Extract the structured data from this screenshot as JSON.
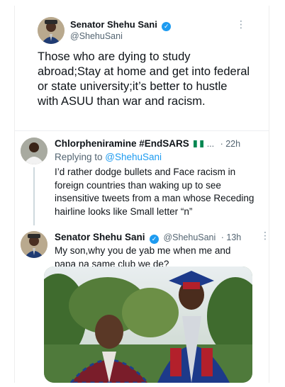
{
  "main_tweet": {
    "author": "Senator Shehu Sani",
    "handle": "@ShehuSani",
    "text": "Those who are dying to study abroad;Stay at home and get into federal or state university;it’s better to hustle with ASUU than war and racism."
  },
  "reply1": {
    "author": "Chlorpheniramine #EndSARS",
    "ellipsis": "...",
    "time": "· 22h",
    "replying_prefix": "Replying to ",
    "replying_handle": "@ShehuSani",
    "text": "I’d rather dodge bullets and Face racism in foreign countries than waking up to see insensitive tweets from a man whose Receding hairline looks like Small letter “n”"
  },
  "reply2": {
    "author": "Senator Shehu Sani",
    "handle": "@ShehuSani",
    "time": "· 13h",
    "text": "My son,why you de yab me when me and papa na same club we de?"
  },
  "icons": {
    "verified": "verified-badge-icon",
    "more": "more-options-icon",
    "flag": "nigeria-flag-icon"
  },
  "colors": {
    "accent": "#1d9bf0",
    "text": "#0f1419",
    "secondary": "#536471"
  }
}
